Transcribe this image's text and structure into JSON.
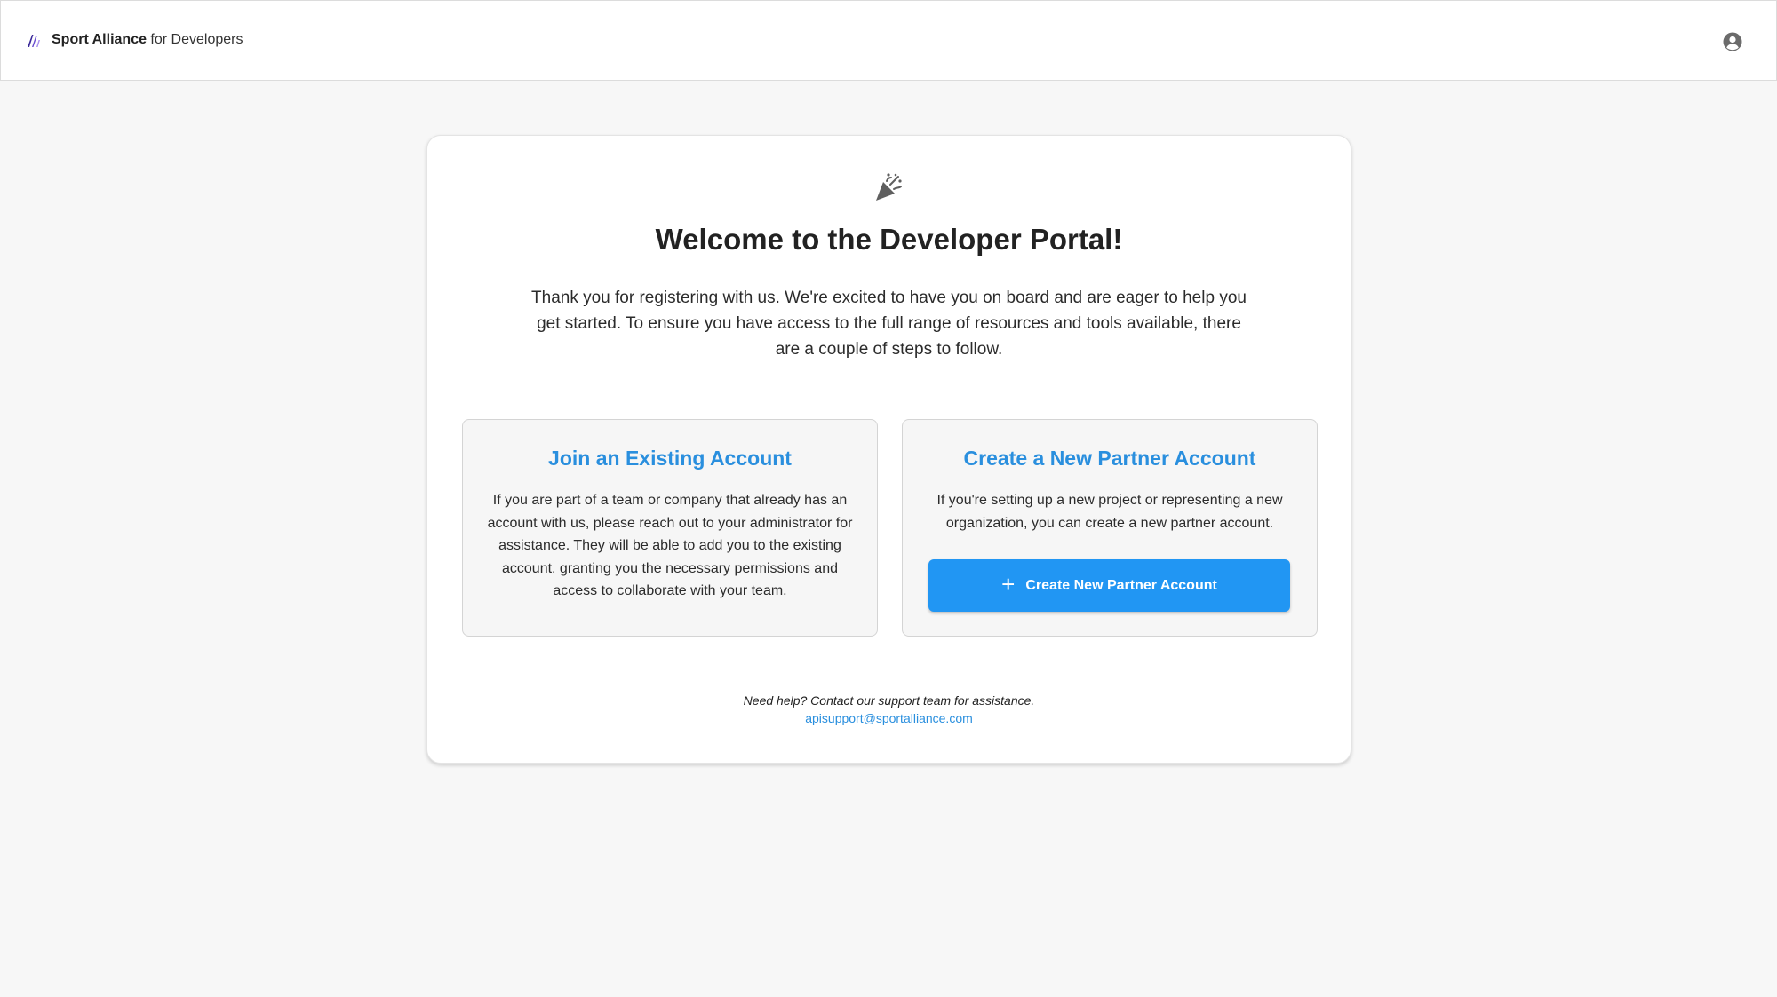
{
  "header": {
    "brand_strong": "Sport Alliance",
    "brand_light": " for Developers",
    "account_icon": "user-circle-icon"
  },
  "welcome": {
    "icon": "party-popper-icon",
    "title": "Welcome to the Developer Portal!",
    "intro": "Thank you for registering with us. We're excited to have you on board and are eager to help you get started. To ensure you have access to the full range of resources and tools available, there are a couple of steps to follow."
  },
  "options": {
    "join": {
      "title": "Join an Existing Account",
      "text": "If you are part of a team or company that already has an account with us, please reach out to your administrator for assistance. They will be able to add you to the existing account, granting you the necessary permissions and access to collaborate with your team."
    },
    "create": {
      "title": "Create a New Partner Account",
      "text": "If you're setting up a new project or representing a new organization, you can create a new partner account.",
      "button_label": "Create New Partner Account",
      "button_icon": "plus-icon"
    }
  },
  "help": {
    "text": "Need help? Contact our support team for assistance.",
    "email": "apisupport@sportalliance.com"
  },
  "colors": {
    "accent": "#2196f3",
    "title_blue": "#2a8fde",
    "background": "#f7f7f7"
  }
}
